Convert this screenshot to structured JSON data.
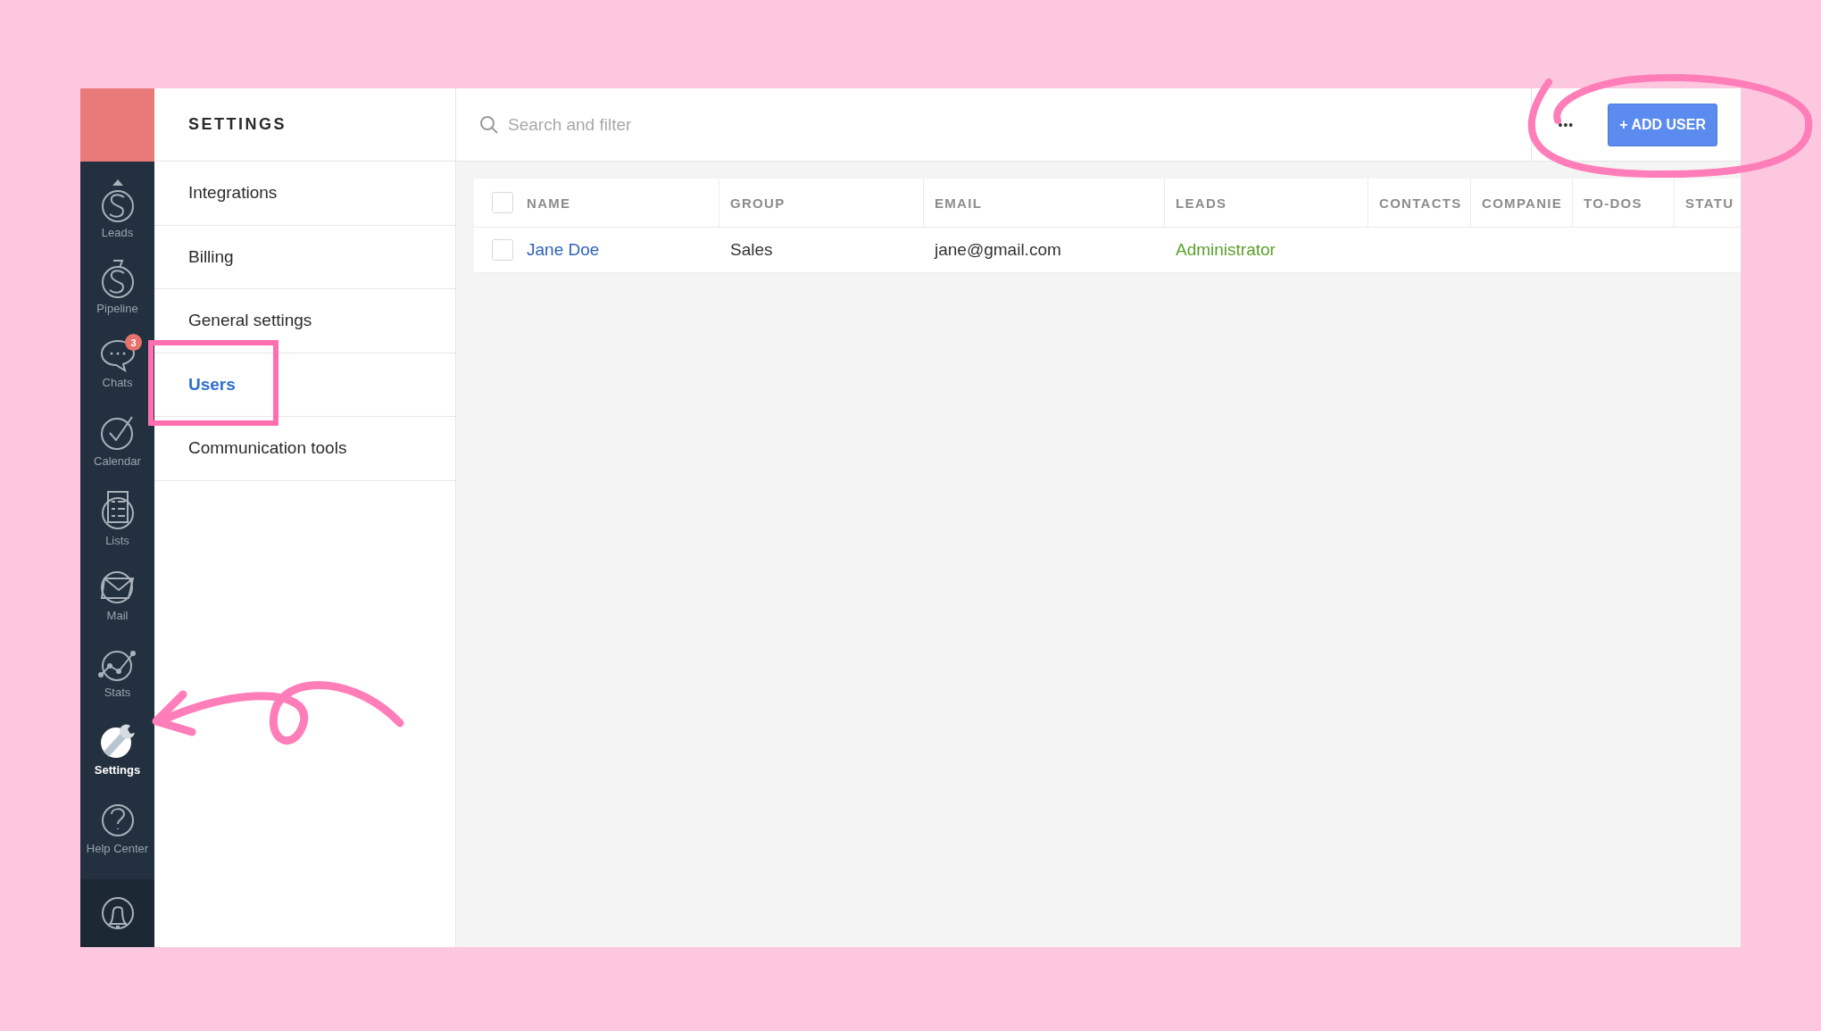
{
  "sidebar": {
    "items": [
      {
        "label": "Leads",
        "selected": false
      },
      {
        "label": "Pipeline",
        "selected": false
      },
      {
        "label": "Chats",
        "selected": false,
        "badge": "3"
      },
      {
        "label": "Calendar",
        "selected": false
      },
      {
        "label": "Lists",
        "selected": false
      },
      {
        "label": "Mail",
        "selected": false
      },
      {
        "label": "Stats",
        "selected": false
      },
      {
        "label": "Settings",
        "selected": true
      },
      {
        "label": "Help Center",
        "selected": false
      }
    ]
  },
  "settings_menu": {
    "title": "SETTINGS",
    "items": [
      {
        "label": "Integrations",
        "selected": false
      },
      {
        "label": "Billing",
        "selected": false
      },
      {
        "label": "General settings",
        "selected": false
      },
      {
        "label": "Users",
        "selected": true
      },
      {
        "label": "Communication tools",
        "selected": false
      }
    ]
  },
  "search": {
    "placeholder": "Search and filter"
  },
  "more_button": "•••",
  "add_button": "+ ADD USER",
  "table": {
    "header_checked": false,
    "columns": [
      "NAME",
      "GROUP",
      "EMAIL",
      "LEADS",
      "CONTACTS",
      "COMPANIE",
      "TO-DOS",
      "STATU"
    ],
    "rows": [
      {
        "checked": false,
        "name": "Jane Doe",
        "group": "Sales",
        "email": "jane@gmail.com",
        "leads": "Administrator"
      }
    ]
  }
}
